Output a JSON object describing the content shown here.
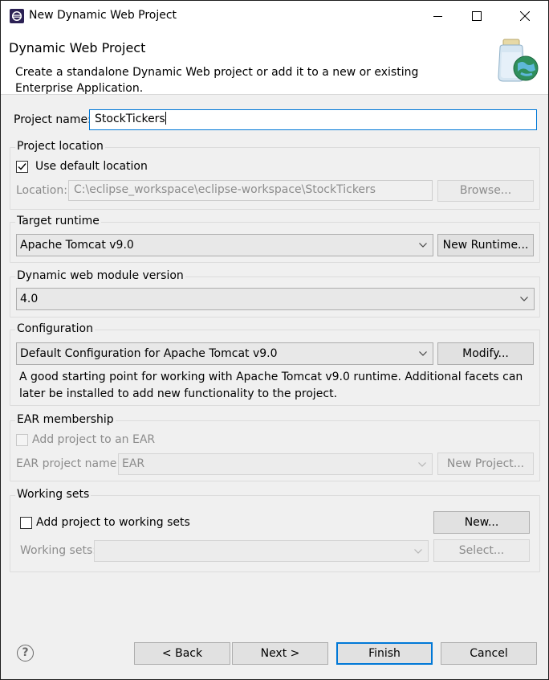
{
  "window": {
    "title": "New Dynamic Web Project"
  },
  "banner": {
    "heading": "Dynamic Web Project",
    "description": "Create a standalone Dynamic Web project or add it to a new or existing Enterprise Application."
  },
  "project_name": {
    "label": "Project name:",
    "value": "StockTickers"
  },
  "project_location": {
    "title": "Project location",
    "use_default_label": "Use default location",
    "use_default_checked": true,
    "location_label": "Location:",
    "location_value": "C:\\eclipse_workspace\\eclipse-workspace\\StockTickers",
    "browse_label": "Browse..."
  },
  "target_runtime": {
    "title": "Target runtime",
    "selected": "Apache Tomcat v9.0",
    "new_runtime_label": "New Runtime..."
  },
  "module_version": {
    "title": "Dynamic web module version",
    "selected": "4.0"
  },
  "configuration": {
    "title": "Configuration",
    "selected": "Default Configuration for Apache Tomcat v9.0",
    "modify_label": "Modify...",
    "info": "A good starting point for working with Apache Tomcat v9.0 runtime. Additional facets can later be installed to add new functionality to the project."
  },
  "ear": {
    "title": "EAR membership",
    "add_label": "Add project to an EAR",
    "add_checked": false,
    "project_name_label": "EAR project name:",
    "project_name_value": "EAR",
    "new_project_label": "New Project..."
  },
  "working_sets": {
    "title": "Working sets",
    "add_label": "Add project to working sets",
    "add_checked": false,
    "new_label": "New...",
    "sets_label": "Working sets:",
    "sets_value": "",
    "select_label": "Select..."
  },
  "footer": {
    "help_glyph": "?",
    "back_label": "< Back",
    "next_label": "Next >",
    "finish_label": "Finish",
    "cancel_label": "Cancel"
  }
}
